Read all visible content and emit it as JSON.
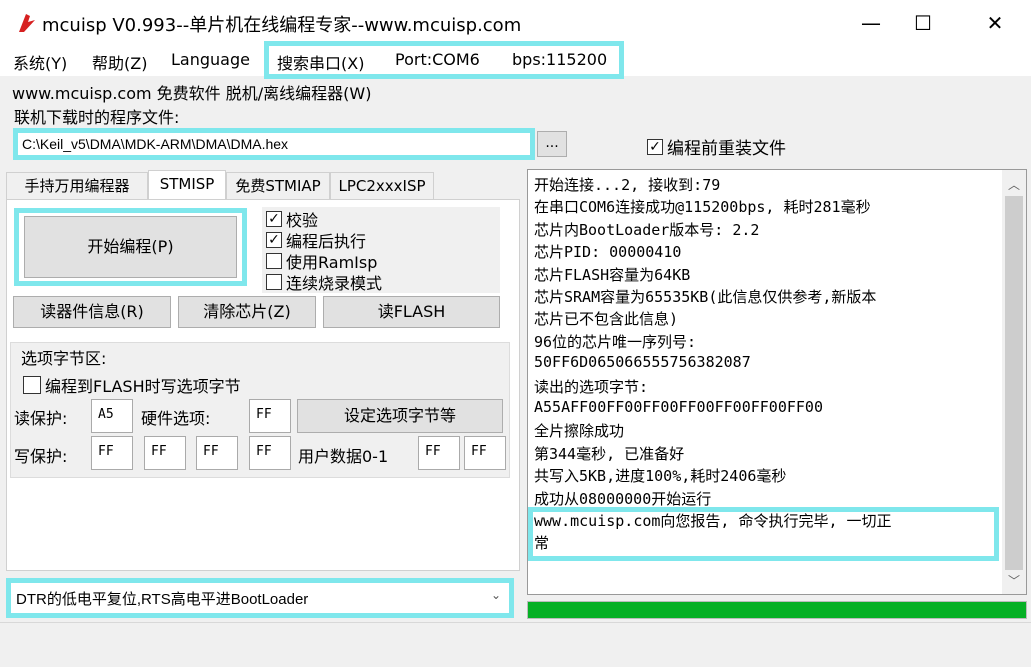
{
  "window": {
    "title": "mcuisp V0.993--单片机在线编程专家--www.mcuisp.com",
    "minimize": "—",
    "maximize": "☐",
    "close": "✕"
  },
  "menu": {
    "items": [
      "系统(Y)",
      "帮助(Z)",
      "Language",
      "搜索串口(X)",
      "Port:COM6",
      "bps:115200"
    ]
  },
  "link_line": "www.mcuisp.com 免费软件 脱机/离线编程器(W)",
  "file": {
    "label": "联机下载时的程序文件:",
    "path": "C:\\Keil_v5\\DMA\\MDK-ARM\\DMA\\DMA.hex",
    "browse": "...",
    "reload_label": "编程前重装文件",
    "reload_checked": true
  },
  "tabs": [
    "手持万用编程器",
    "STMISP",
    "免费STMIAP",
    "LPC2xxxISP"
  ],
  "active_tab": 1,
  "stmisp": {
    "start_button": "开始编程(P)",
    "options": [
      {
        "label": "校验",
        "checked": true
      },
      {
        "label": "编程后执行",
        "checked": true
      },
      {
        "label": "使用RamIsp",
        "checked": false
      },
      {
        "label": "连续烧录模式",
        "checked": false
      }
    ],
    "read_info_button": "读器件信息(R)",
    "erase_button": "清除芯片(Z)",
    "read_flash_button": "读FLASH",
    "option_bytes": {
      "group_title": "选项字节区:",
      "write_to_flash_label": "编程到FLASH时写选项字节",
      "write_to_flash_checked": false,
      "read_protect_label": "读保护:",
      "read_protect_value": "A5",
      "hw_option_label": "硬件选项:",
      "hw_option_value": "FF",
      "set_button": "设定选项字节等",
      "write_protect_label": "写保护:",
      "write_protect_values": [
        "FF",
        "FF",
        "FF",
        "FF"
      ],
      "user_data_label": "用户数据0-1",
      "user_data_values": [
        "FF",
        "FF"
      ]
    },
    "reset_mode": "DTR的低电平复位,RTS高电平进BootLoader"
  },
  "log": [
    "开始连接...2, 接收到:79",
    "在串口COM6连接成功@115200bps, 耗时281毫秒",
    "芯片内BootLoader版本号: 2.2",
    "芯片PID: 00000410",
    "芯片FLASH容量为64KB",
    "芯片SRAM容量为65535KB(此信息仅供参考,新版本",
    "芯片已不包含此信息)",
    "96位的芯片唯一序列号:",
    "50FF6D065066555756382087",
    "读出的选项字节:",
    "A55AFF00FF00FF00FF00FF00FF00FF00",
    "全片擦除成功",
    "第344毫秒, 已准备好",
    "共写入5KB,进度100%,耗时2406毫秒",
    "成功从08000000开始运行",
    "www.mcuisp.com向您报告, 命令执行完毕, 一切正",
    "常"
  ],
  "progress_fraction": 1.0,
  "colors": {
    "highlight": "#7fe7ec",
    "progress": "#06b025",
    "app_icon": "#d62020"
  }
}
